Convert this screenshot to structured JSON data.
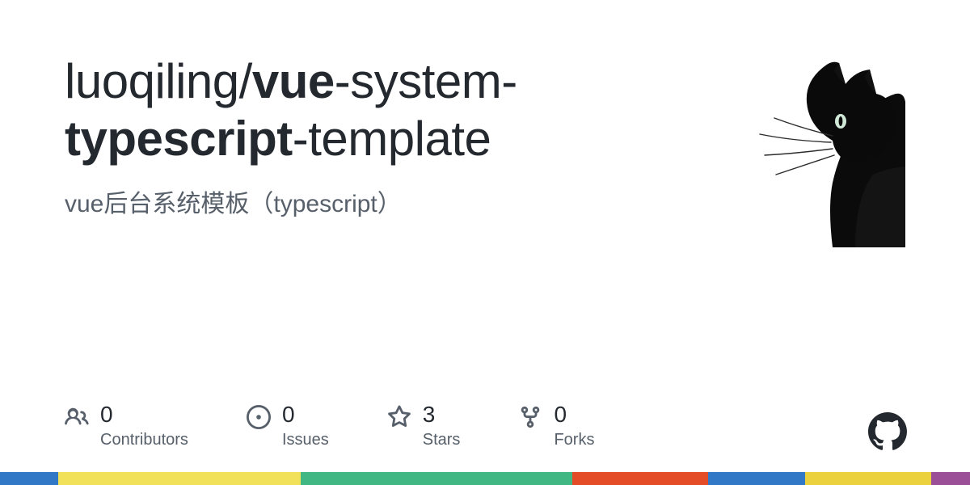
{
  "repo": {
    "owner": "luoqiling",
    "name_segments": [
      {
        "text": "vue",
        "bold": true
      },
      {
        "text": "-system-",
        "bold": false
      },
      {
        "text": "typescript",
        "bold": true
      },
      {
        "text": "-template",
        "bold": false
      }
    ],
    "description": "vue后台系统模板（typescript）"
  },
  "avatar": {
    "alt": "black-cat-avatar"
  },
  "stats": {
    "contributors": {
      "count": "0",
      "label": "Contributors"
    },
    "issues": {
      "count": "0",
      "label": "Issues"
    },
    "stars": {
      "count": "3",
      "label": "Stars"
    },
    "forks": {
      "count": "0",
      "label": "Forks"
    }
  },
  "language_bar": [
    {
      "color": "#3178c6",
      "percent": 6
    },
    {
      "color": "#f1e05a",
      "percent": 25
    },
    {
      "color": "#41b883",
      "percent": 28
    },
    {
      "color": "#e34c26",
      "percent": 14
    },
    {
      "color": "#3178c6",
      "percent": 10
    },
    {
      "color": "#ecd13f",
      "percent": 13
    },
    {
      "color": "#9b4f96",
      "percent": 4
    }
  ]
}
